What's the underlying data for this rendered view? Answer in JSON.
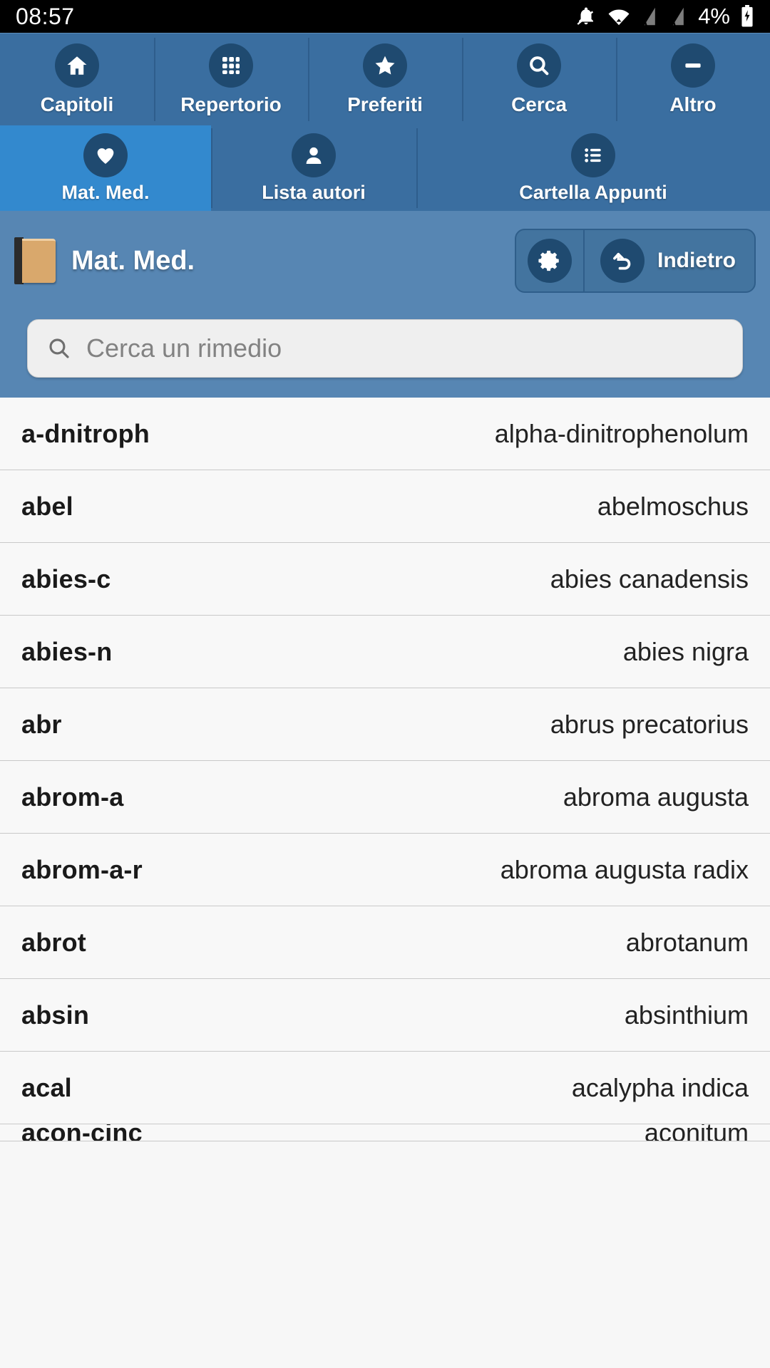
{
  "statusbar": {
    "time": "08:57",
    "battery_percent": "4%",
    "icons": [
      "notifications-silenced-icon",
      "wifi-icon",
      "signal-off-icon",
      "signal-off-icon",
      "battery-charging-icon"
    ]
  },
  "primary_tabs": [
    {
      "label": "Capitoli",
      "icon": "home-icon"
    },
    {
      "label": "Repertorio",
      "icon": "grid-icon"
    },
    {
      "label": "Preferiti",
      "icon": "star-icon"
    },
    {
      "label": "Cerca",
      "icon": "search-icon"
    },
    {
      "label": "Altro",
      "icon": "minus-icon"
    }
  ],
  "secondary_tabs": [
    {
      "label": "Mat. Med.",
      "icon": "heart-icon",
      "selected": true
    },
    {
      "label": "Lista autori",
      "icon": "person-icon",
      "selected": false
    },
    {
      "label": "Cartella Appunti",
      "icon": "list-icon",
      "selected": false
    }
  ],
  "titlebar": {
    "icon": "book-icon",
    "title": "Mat. Med.",
    "settings_icon": "gear-icon",
    "back_icon": "back-arrow-icon",
    "back_label": "Indietro"
  },
  "search": {
    "icon": "search-icon",
    "value": "",
    "placeholder": "Cerca un rimedio"
  },
  "list": {
    "rows": [
      {
        "abbr": "a-dnitroph",
        "name": "alpha-dinitrophenolum"
      },
      {
        "abbr": "abel",
        "name": "abelmoschus"
      },
      {
        "abbr": "abies-c",
        "name": "abies canadensis"
      },
      {
        "abbr": "abies-n",
        "name": "abies nigra"
      },
      {
        "abbr": "abr",
        "name": "abrus precatorius"
      },
      {
        "abbr": "abrom-a",
        "name": "abroma augusta"
      },
      {
        "abbr": "abrom-a-r",
        "name": "abroma augusta radix"
      },
      {
        "abbr": "abrot",
        "name": "abrotanum"
      },
      {
        "abbr": "absin",
        "name": "absinthium"
      },
      {
        "abbr": "acal",
        "name": "acalypha indica"
      },
      {
        "abbr": "acon-cinc",
        "name": "aconitum"
      }
    ]
  },
  "colors": {
    "tabbar": "#3a6ea0",
    "tab_selected": "#3389ce",
    "titlebar": "#5786b3",
    "icon_circle": "#1f4a70",
    "list_bg": "#f8f8f8",
    "divider": "#c9c9c9"
  }
}
